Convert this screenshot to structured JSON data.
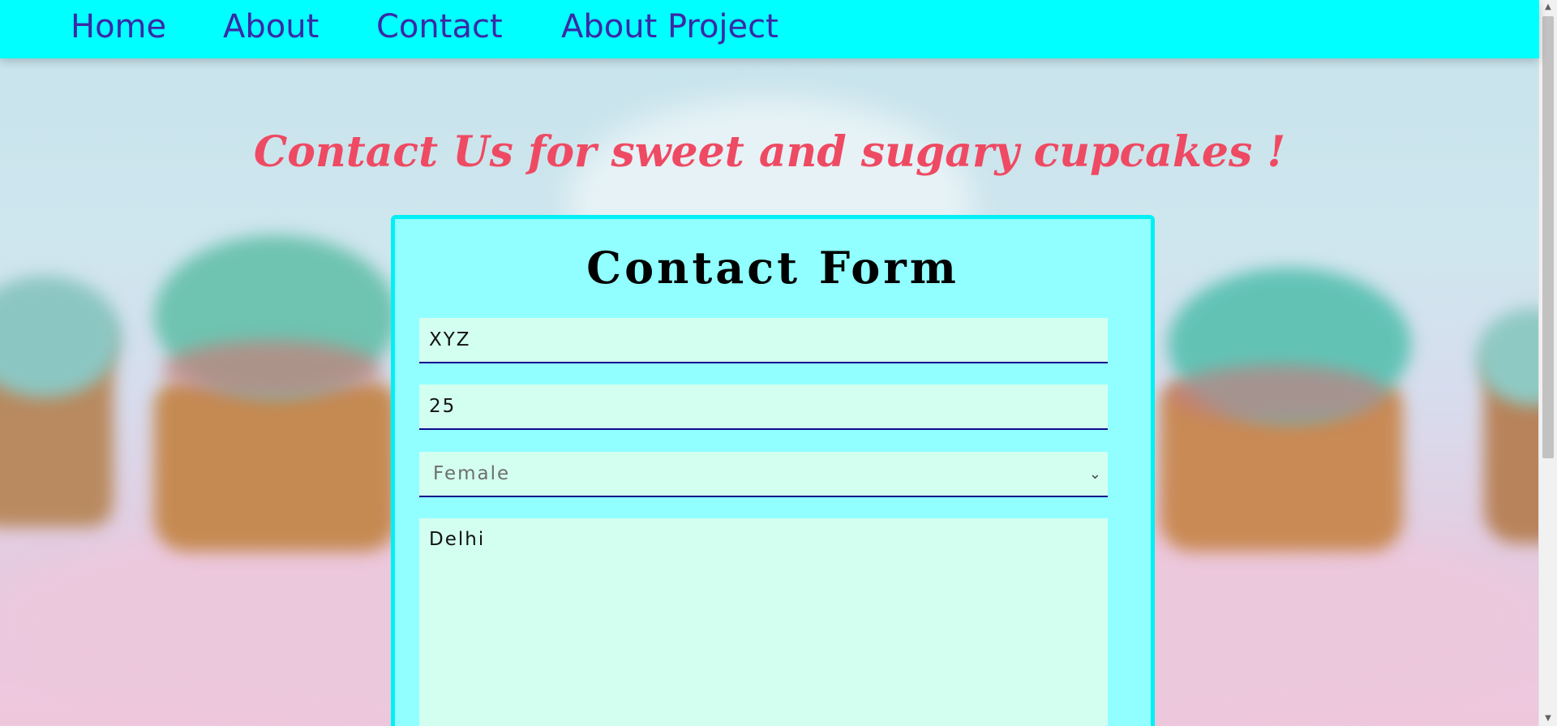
{
  "nav": {
    "items": [
      {
        "label": "Home"
      },
      {
        "label": "About"
      },
      {
        "label": "Contact"
      },
      {
        "label": "About Project"
      }
    ]
  },
  "page": {
    "heading": "Contact Us for sweet and sugary cupcakes !"
  },
  "form": {
    "title": "Contact Form",
    "name_value": "XYZ",
    "age_value": "25",
    "gender_selected": "Female",
    "address_value": "Delhi"
  },
  "colors": {
    "navbar_bg": "#00ffff",
    "nav_text": "#3a2aa6",
    "heading": "#ef4a63",
    "card_bg": "#91ffff",
    "card_border": "#00f0f5",
    "field_bg": "#d3fff0",
    "field_underline": "#0b0b8c"
  },
  "icons": {
    "select_chevron": "chevron-down-icon",
    "textarea_resize": "resize-handle-icon"
  }
}
